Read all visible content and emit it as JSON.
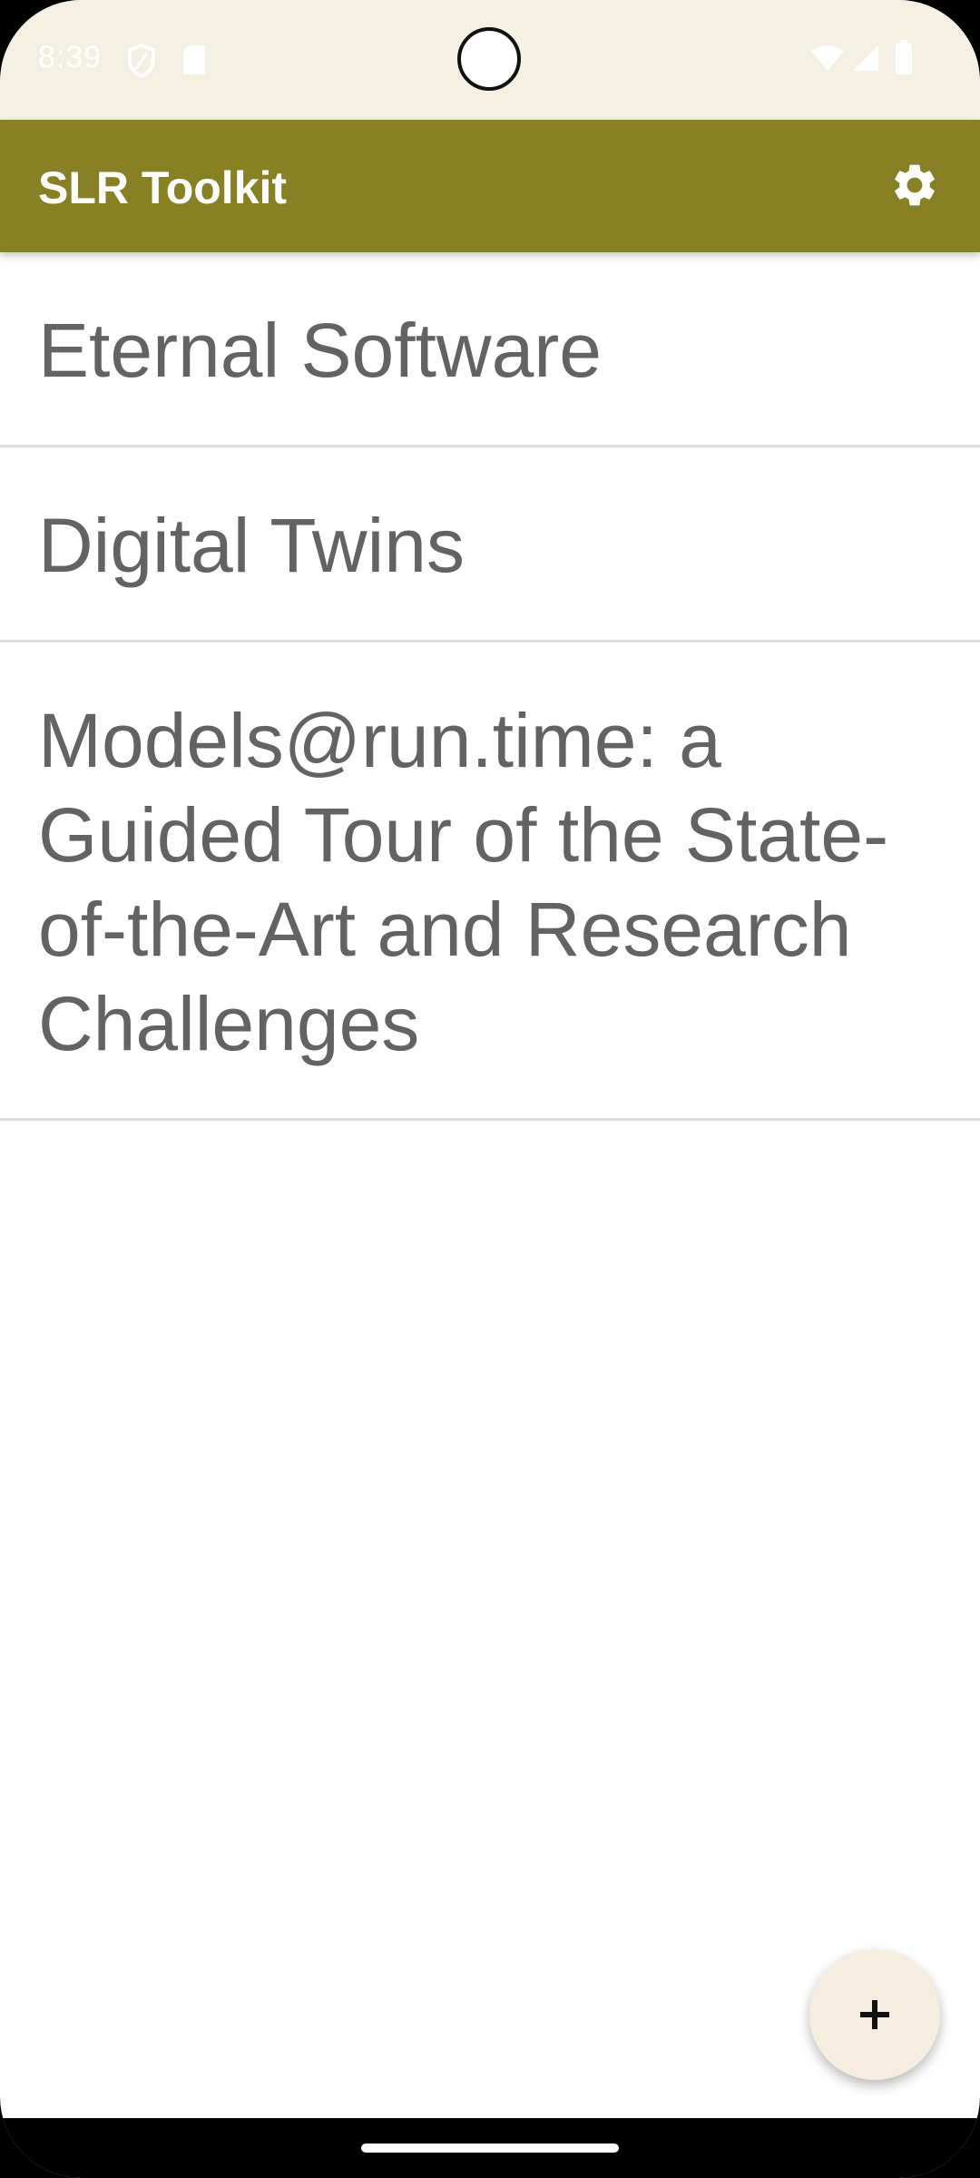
{
  "status_bar": {
    "time": "8:39",
    "icons_left": [
      "shield-icon",
      "sd-card-icon"
    ],
    "icons_right": [
      "wifi-icon",
      "signal-icon",
      "battery-icon"
    ]
  },
  "app_bar": {
    "title": "SLR Toolkit",
    "action_icon": "gear-icon",
    "color": "#878024"
  },
  "projects": [
    {
      "title": "Eternal Software"
    },
    {
      "title": "Digital Twins"
    },
    {
      "title": "Models@run.time: a Guided Tour of the State-of-the-Art and Research Challenges"
    }
  ],
  "fab": {
    "icon": "plus-icon",
    "color": "#f5ede0"
  }
}
